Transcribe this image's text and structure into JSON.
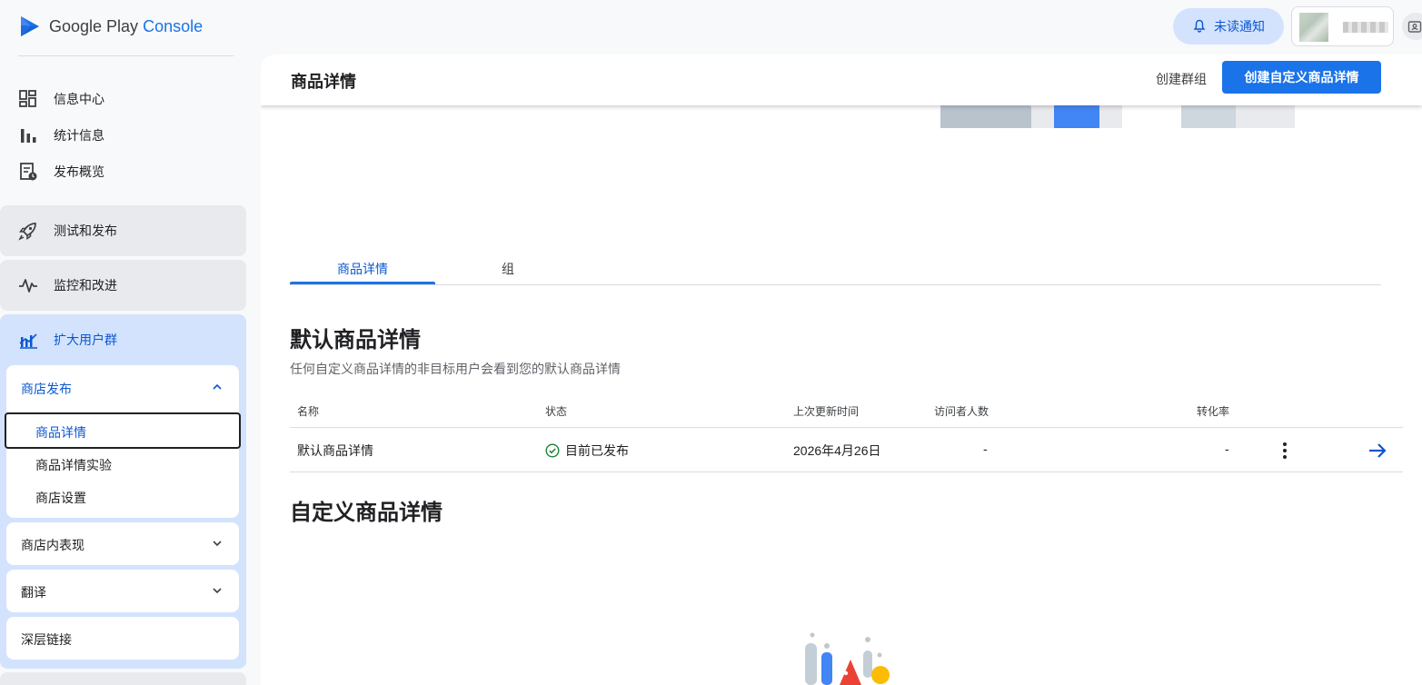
{
  "app": {
    "logo_main": "Google Play",
    "logo_product": "Console"
  },
  "header": {
    "notifications_label": "未读通知"
  },
  "sidebar": {
    "items": [
      {
        "label": "信息中心",
        "icon": "dashboard-icon"
      },
      {
        "label": "统计信息",
        "icon": "bar-chart-icon"
      },
      {
        "label": "发布概览",
        "icon": "publishing-overview-icon"
      }
    ],
    "sections": [
      {
        "label": "测试和发布",
        "icon": "rocket-icon"
      },
      {
        "label": "监控和改进",
        "icon": "pulse-icon"
      },
      {
        "label": "扩大用户群",
        "icon": "grow-users-icon"
      }
    ],
    "store_presence": {
      "header": "商店发布",
      "items": [
        "商品详情",
        "商品详情实验",
        "商店设置"
      ],
      "selected": "商品详情"
    },
    "cards": [
      "商店内表现",
      "翻译",
      "深层链接"
    ]
  },
  "main": {
    "title": "商品详情",
    "create_group": "创建群组",
    "create_custom": "创建自定义商品详情",
    "tabs": [
      "商品详情",
      "组"
    ],
    "active_tab": 0,
    "default_section": {
      "title": "默认商品详情",
      "description": "任何自定义商品详情的非目标用户会看到您的默认商品详情"
    },
    "table": {
      "headers": [
        "名称",
        "状态",
        "上次更新时间",
        "访问者人数",
        "转化率"
      ],
      "rows": [
        {
          "name": "默认商品详情",
          "status": "目前已发布",
          "updated": "2026年4月26日",
          "visitors": "-",
          "conversion": "-"
        }
      ]
    },
    "custom_section": {
      "title": "自定义商品详情"
    }
  },
  "colors": {
    "accent": "#1a73e8",
    "active_nav_bg": "#d3e3fd",
    "success": "#188038"
  }
}
